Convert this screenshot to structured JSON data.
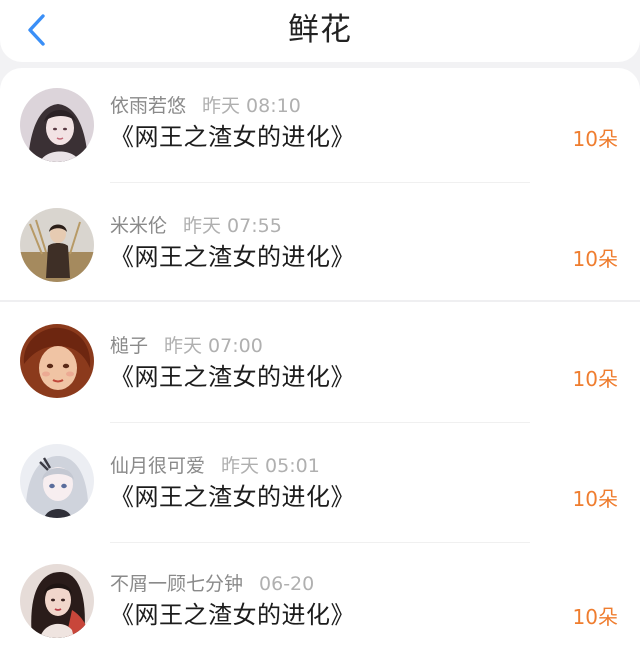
{
  "header": {
    "title": "鲜花",
    "back_icon": "chevron-left-icon",
    "accent_color": "#3a8ff7"
  },
  "records": [
    {
      "user": "依雨若悠",
      "time": "昨天 08:10",
      "book": "《网王之渣女的进化》",
      "count": "10朵"
    },
    {
      "user": "米米伦",
      "time": "昨天 07:55",
      "book": "《网王之渣女的进化》",
      "count": "10朵"
    },
    {
      "user": "槌子",
      "time": "昨天 07:00",
      "book": "《网王之渣女的进化》",
      "count": "10朵"
    },
    {
      "user": "仙月很可爱",
      "time": "昨天 05:01",
      "book": "《网王之渣女的进化》",
      "count": "10朵"
    },
    {
      "user": "不屑一顾七分钟",
      "time": "06-20",
      "book": "《网王之渣女的进化》",
      "count": "10朵"
    }
  ],
  "colors": {
    "count": "#ef7d2f",
    "username": "#8a8a8a",
    "timestamp": "#b0b0b0",
    "title_text": "#222222"
  }
}
